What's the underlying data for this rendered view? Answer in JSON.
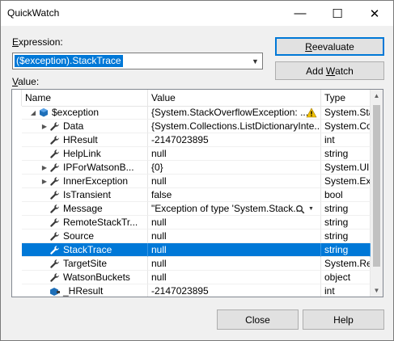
{
  "window": {
    "title": "QuickWatch",
    "minimize_glyph": "—",
    "maximize_glyph": "☐",
    "close_glyph": "✕"
  },
  "expression": {
    "label_u": "E",
    "label_rest": "xpression:",
    "value": "($exception).StackTrace"
  },
  "buttons": {
    "reevaluate_u": "R",
    "reevaluate_rest": "eevaluate",
    "add_watch_a": "Add ",
    "add_watch_u": "W",
    "add_watch_rest": "atch",
    "close": "Close",
    "help": "Help"
  },
  "value_label": {
    "label_u": "V",
    "label_rest": "alue:"
  },
  "columns": [
    "Name",
    "Value",
    "Type"
  ],
  "rows": [
    {
      "name": "$exception",
      "value": "{System.StackOverflowException: ...",
      "type": "System.Sta...",
      "indent": 0,
      "expander": "expanded",
      "icon": "object-icon",
      "warning": true
    },
    {
      "name": "Data",
      "value": "{System.Collections.ListDictionaryInte...",
      "type": "System.Col...",
      "indent": 1,
      "expander": "collapsed",
      "icon": "wrench-icon"
    },
    {
      "name": "HResult",
      "value": "-2147023895",
      "type": "int",
      "indent": 1,
      "expander": "none",
      "icon": "wrench-icon"
    },
    {
      "name": "HelpLink",
      "value": "null",
      "type": "string",
      "indent": 1,
      "expander": "none",
      "icon": "wrench-icon"
    },
    {
      "name": "IPForWatsonB...",
      "value": "{0}",
      "type": "System.UIn...",
      "indent": 1,
      "expander": "collapsed",
      "icon": "wrench-icon"
    },
    {
      "name": "InnerException",
      "value": "null",
      "type": "System.Exc...",
      "indent": 1,
      "expander": "collapsed",
      "icon": "wrench-icon"
    },
    {
      "name": "IsTransient",
      "value": "false",
      "type": "bool",
      "indent": 1,
      "expander": "none",
      "icon": "wrench-icon"
    },
    {
      "name": "Message",
      "value": "\"Exception of type 'System.Stack...",
      "type": "string",
      "indent": 1,
      "expander": "none",
      "icon": "wrench-icon",
      "magnifier": true
    },
    {
      "name": "RemoteStackTr...",
      "value": "null",
      "type": "string",
      "indent": 1,
      "expander": "none",
      "icon": "wrench-icon"
    },
    {
      "name": "Source",
      "value": "null",
      "type": "string",
      "indent": 1,
      "expander": "none",
      "icon": "wrench-icon"
    },
    {
      "name": "StackTrace",
      "value": "null",
      "type": "string",
      "indent": 1,
      "expander": "none",
      "icon": "wrench-icon",
      "selected": true
    },
    {
      "name": "TargetSite",
      "value": "null",
      "type": "System.Ref...",
      "indent": 1,
      "expander": "none",
      "icon": "wrench-icon"
    },
    {
      "name": "WatsonBuckets",
      "value": "null",
      "type": "object",
      "indent": 1,
      "expander": "none",
      "icon": "wrench-icon"
    },
    {
      "name": "_HResult",
      "value": "-2147023895",
      "type": "int",
      "indent": 1,
      "expander": "none",
      "icon": "field-icon"
    }
  ],
  "colors": {
    "selection": "#0078d7",
    "accent_border": "#0078d7",
    "warning": "#f0c000"
  }
}
